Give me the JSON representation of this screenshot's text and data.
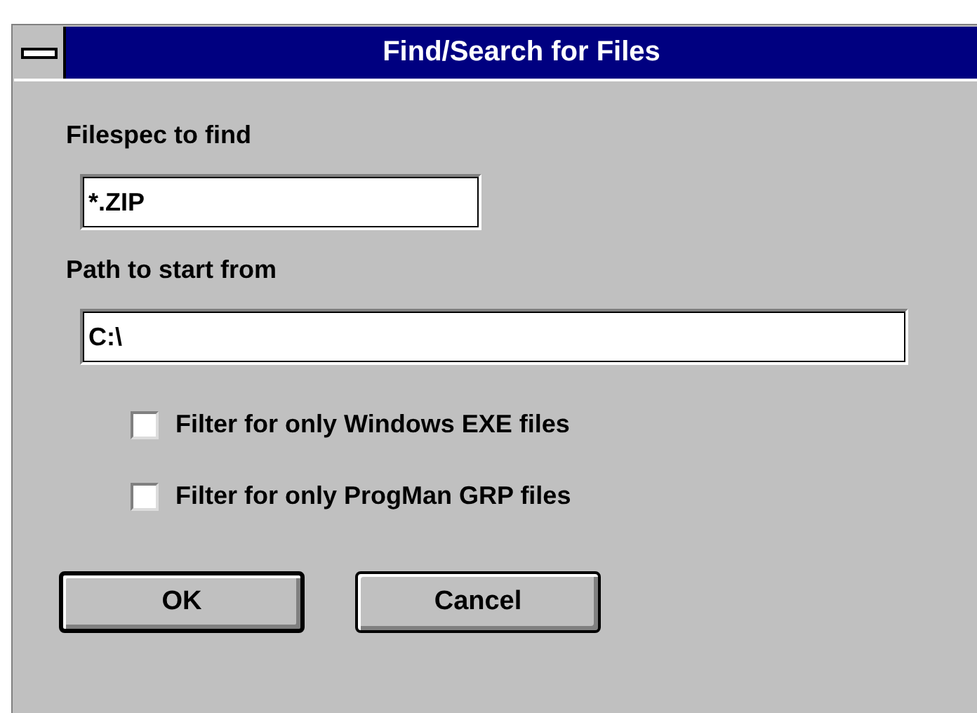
{
  "window": {
    "title": "Find/Search for Files"
  },
  "fields": [
    {
      "label": "Filespec to find",
      "value": "*.ZIP",
      "kind": "short"
    },
    {
      "label": "Path to start from",
      "value": "C:\\",
      "kind": "long"
    }
  ],
  "checkboxes": [
    {
      "label": "Filter for only Windows EXE files",
      "checked": false
    },
    {
      "label": "Filter for only ProgMan GRP files",
      "checked": false
    }
  ],
  "buttons": [
    {
      "label": "OK",
      "default": true
    },
    {
      "label": "Cancel",
      "default": false
    }
  ]
}
